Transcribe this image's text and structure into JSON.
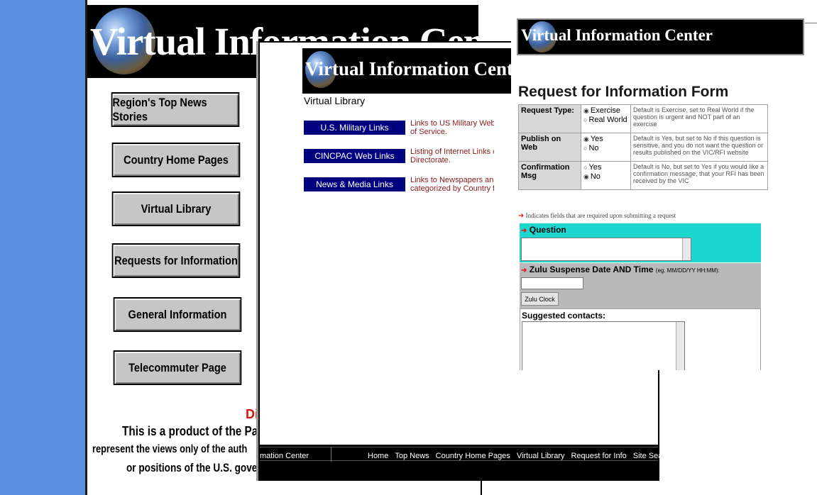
{
  "window_home": {
    "banner_title": "Virtual Information Center",
    "nav_buttons": [
      "Region's Top News Stories",
      "Country Home Pages",
      "Virtual Library",
      "Requests for Information",
      "General Information",
      "Telecommuter Page"
    ],
    "disclaimer_heading": "Di",
    "disclaimer_lines": [
      "This is a product of the Pacific",
      "represent the views only of the auth",
      "or positions of the U.S. gover"
    ]
  },
  "window_library": {
    "banner_title": "Virtual Information Center",
    "heading": "Virtual Library",
    "links": [
      {
        "label": "U.S. Military Links",
        "description_lines": [
          "Links to US Military Web Sites onli",
          "of Service."
        ]
      },
      {
        "label": "CINCPAC Web Links",
        "description_lines": [
          "Listing of Internet Links commonly",
          "Directorate."
        ]
      },
      {
        "label": "News & Media Links",
        "description_lines": [
          "Links to Newspapers and News Me",
          "categorized by Country for quick re"
        ]
      }
    ],
    "footer": {
      "brand": "mation Center",
      "nav": [
        "Home",
        "Top News",
        "Country Home Pages",
        "Virtual Library",
        "Request for Info",
        "Site Search"
      ]
    }
  },
  "window_rfi": {
    "banner_title": "Virtual Information Center",
    "form_title": "Request for Information Form",
    "options": [
      {
        "label": "Request Type:",
        "choices": [
          {
            "text": "Exercise",
            "selected": true
          },
          {
            "text": "Real World",
            "selected": false
          }
        ],
        "note": "Default is Exercise, set to Real World if the question is urgent and NOT part of an exercise"
      },
      {
        "label": "Publish on Web",
        "choices": [
          {
            "text": "Yes",
            "selected": true
          },
          {
            "text": "No",
            "selected": false
          }
        ],
        "note": "Default is Yes, but set to No if this question is sensitive, and you do not want the question or results published on the VIC/RFI website"
      },
      {
        "label": "Confirmation Msg",
        "choices": [
          {
            "text": "Yes",
            "selected": false
          },
          {
            "text": "No",
            "selected": true
          }
        ],
        "note": "Default is No, but set to Yes if you would like a confirmation message, that your RFI has been received by the VIC"
      }
    ],
    "required_note": "Indicates fields that are required upon submitting a request",
    "question_label": "Question",
    "question_value": "",
    "zulu_label": "Zulu Suspense Date AND Time",
    "zulu_hint": "(eg. MM/DD/YY HH:MM):",
    "zulu_value": "",
    "zulu_button": "Zulu Clock",
    "contacts_label": "Suggested contacts:",
    "contacts_value": ""
  },
  "colors": {
    "side_strip": "#5b8fe0",
    "banner": "#000000",
    "nav_button": "#c6c6c6",
    "library_link": "#000080",
    "library_description": "#8b1a1a",
    "question_bg": "#1ed6d0",
    "zulu_bg": "#b9b9b9",
    "disclaimer_heading": "#e01010",
    "required_arrow": "#e02020"
  }
}
